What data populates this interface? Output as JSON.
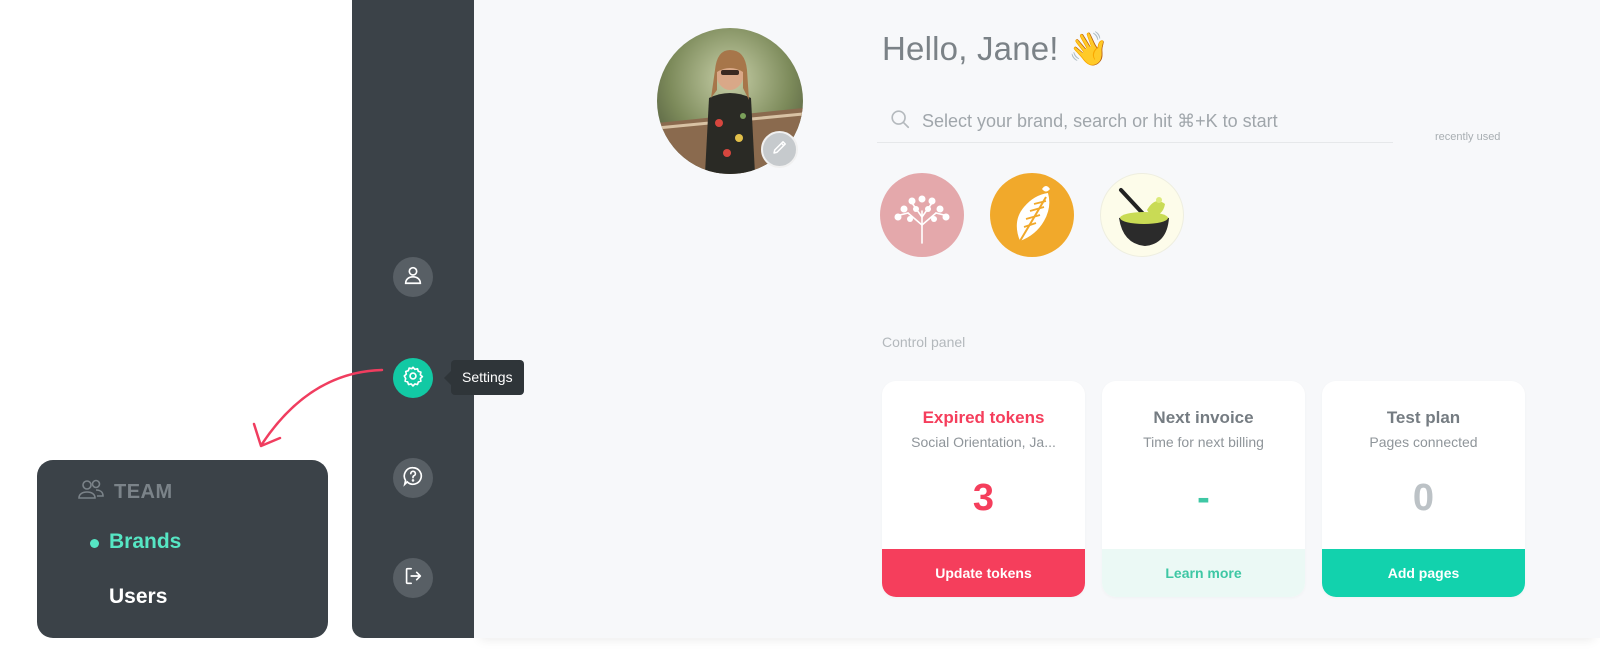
{
  "user": {
    "greeting": "Hello, Jane!",
    "greeting_emoji": "👋"
  },
  "search": {
    "placeholder": "Select your brand, search or hit ⌘+K to start",
    "recent_label": "recently used"
  },
  "brands": [
    {
      "name": "brand-blossom",
      "color": "#e4a8ab"
    },
    {
      "name": "brand-latte-art",
      "color": "#f1a92b"
    },
    {
      "name": "brand-matcha",
      "color": "#fdfcea"
    }
  ],
  "sidebar": {
    "items": [
      {
        "icon": "user-icon"
      },
      {
        "icon": "gear-icon",
        "active": true
      },
      {
        "icon": "help-icon"
      },
      {
        "icon": "logout-icon"
      }
    ],
    "tooltip": "Settings"
  },
  "control_panel": {
    "label": "Control panel",
    "cards": [
      {
        "title": "Expired tokens",
        "subtitle": "Social Orientation, Ja...",
        "value": "3",
        "button": "Update tokens",
        "accent": "#f53e5c"
      },
      {
        "title": "Next invoice",
        "subtitle": "Time for next billing",
        "value": "-",
        "button": "Learn more",
        "accent": "#3ec7a4"
      },
      {
        "title": "Test plan",
        "subtitle": "Pages connected",
        "value": "0",
        "button": "Add pages",
        "accent": "#12d2ad"
      }
    ]
  },
  "team_menu": {
    "heading": "TEAM",
    "items": [
      {
        "label": "Brands",
        "active": true
      },
      {
        "label": "Users",
        "active": false
      }
    ]
  },
  "colors": {
    "rail": "#3b4248",
    "accent": "#12c9a4",
    "danger": "#f53e5c"
  }
}
